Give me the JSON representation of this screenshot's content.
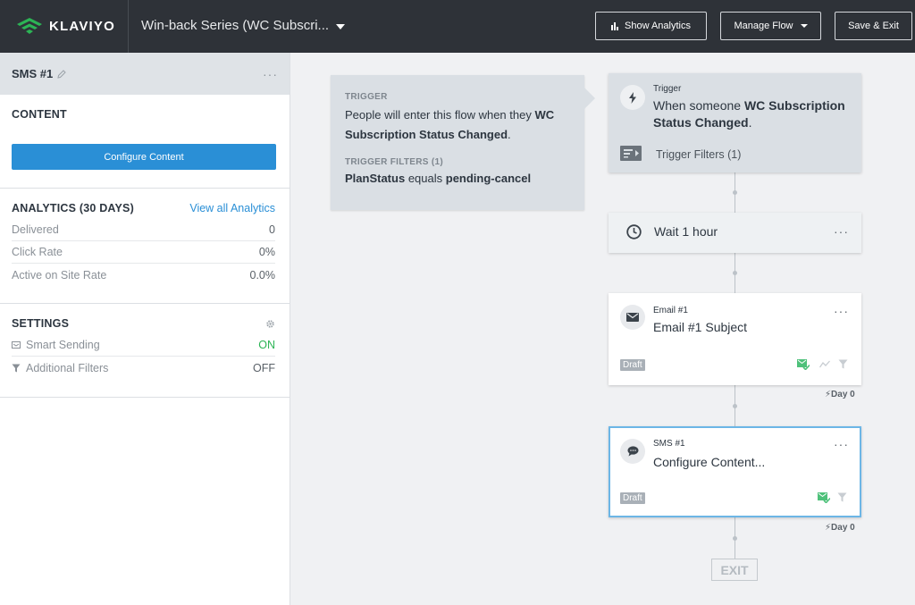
{
  "brand": {
    "name": "KLAVIYO",
    "accent": "#2cb455"
  },
  "header": {
    "flow_title": "Win-back Series (WC Subscri...",
    "show_analytics": "Show Analytics",
    "manage_flow": "Manage Flow",
    "save_exit": "Save & Exit"
  },
  "sidebar": {
    "title": "SMS #1",
    "content_heading": "CONTENT",
    "configure_button": "Configure Content",
    "analytics_heading": "ANALYTICS (30 DAYS)",
    "analytics_link": "View all Analytics",
    "analytics_rows": [
      {
        "label": "Delivered",
        "value": "0"
      },
      {
        "label": "Click Rate",
        "value": "0%"
      },
      {
        "label": "Active on Site Rate",
        "value": "0.0%"
      }
    ],
    "settings_heading": "SETTINGS",
    "settings_rows": [
      {
        "label": "Smart Sending",
        "value": "ON"
      },
      {
        "label": "Additional Filters",
        "value": "OFF"
      }
    ]
  },
  "trigger_info": {
    "trigger_caption": "TRIGGER",
    "trigger_text_prefix": "People will enter this flow when they",
    "trigger_text_bold": "WC Subscription Status Changed",
    "trigger_text_suffix": ".",
    "filters_caption": "TRIGGER FILTERS (1)",
    "filter_field": "PlanStatus",
    "filter_op": "equals",
    "filter_value": "pending-cancel"
  },
  "flow": {
    "trigger": {
      "caption": "Trigger",
      "text_prefix": "When someone",
      "text_bold": "WC Subscription Status Changed",
      "text_suffix": ".",
      "filters_label": "Trigger Filters (1)"
    },
    "wait": {
      "label": "Wait 1 hour"
    },
    "email": {
      "caption": "Email #1",
      "subject": "Email #1 Subject",
      "status": "Draft",
      "day": "Day 0"
    },
    "sms": {
      "caption": "SMS #1",
      "subject": "Configure Content...",
      "status": "Draft",
      "day": "Day 0"
    },
    "exit_label": "EXIT"
  }
}
